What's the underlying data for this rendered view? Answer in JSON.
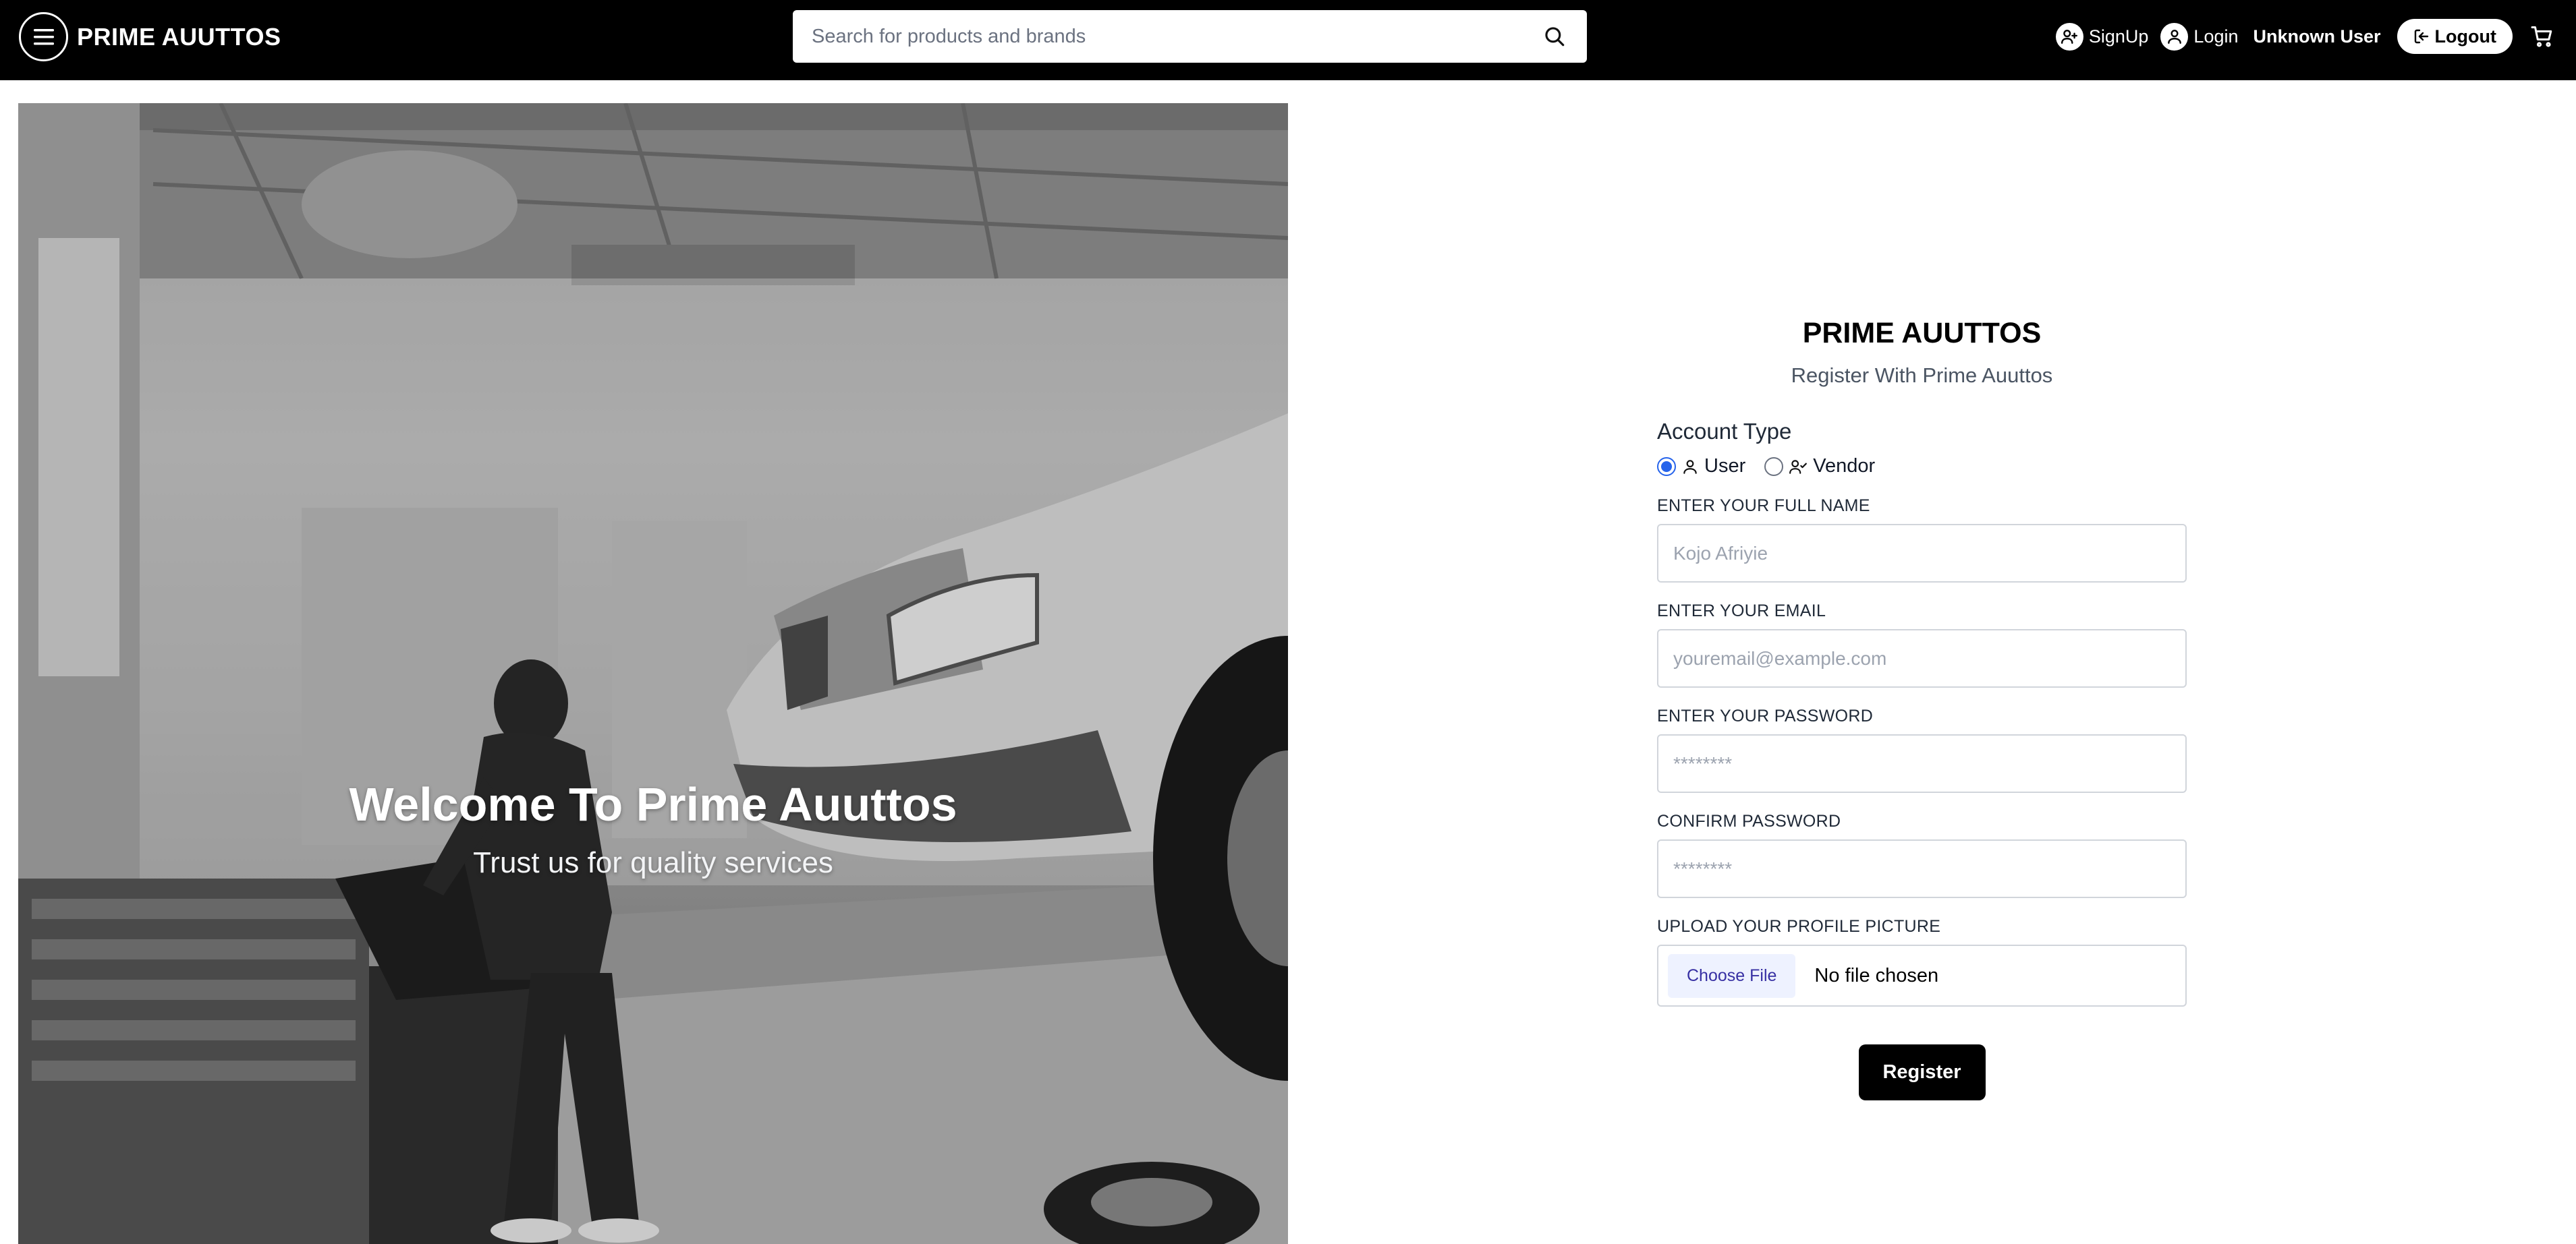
{
  "header": {
    "brand": "PRIME AUUTTOS",
    "search_placeholder": "Search for products and brands",
    "signup_label": "SignUp",
    "login_label": "Login",
    "user_name": "Unknown User",
    "logout_label": "Logout"
  },
  "hero": {
    "title": "Welcome To Prime Auuttos",
    "subtitle": "Trust us for quality services"
  },
  "form": {
    "title": "PRIME AUUTTOS",
    "subtitle": "Register With Prime Auuttos",
    "account_type_label": "Account Type",
    "account_types": [
      {
        "label": "User",
        "selected": true
      },
      {
        "label": "Vendor",
        "selected": false
      }
    ],
    "fields": {
      "full_name": {
        "label": "ENTER YOUR FULL NAME",
        "placeholder": "Kojo Afriyie"
      },
      "email": {
        "label": "ENTER YOUR EMAIL",
        "placeholder": "youremail@example.com"
      },
      "password": {
        "label": "ENTER YOUR PASSWORD",
        "placeholder": "********"
      },
      "confirm_password": {
        "label": "CONFIRM PASSWORD",
        "placeholder": "********"
      },
      "profile_picture": {
        "label": "UPLOAD YOUR PROFILE PICTURE",
        "button": "Choose File",
        "status": "No file chosen"
      }
    },
    "register_label": "Register"
  },
  "icons": {
    "menu": "menu-icon",
    "search": "search-icon",
    "signup": "user-plus-icon",
    "login": "user-icon",
    "logout": "logout-icon",
    "cart": "cart-icon",
    "user_type": "user-icon",
    "vendor_type": "user-check-icon"
  },
  "colors": {
    "header_bg": "#000000",
    "accent": "#2563eb",
    "button_bg": "#000000"
  }
}
